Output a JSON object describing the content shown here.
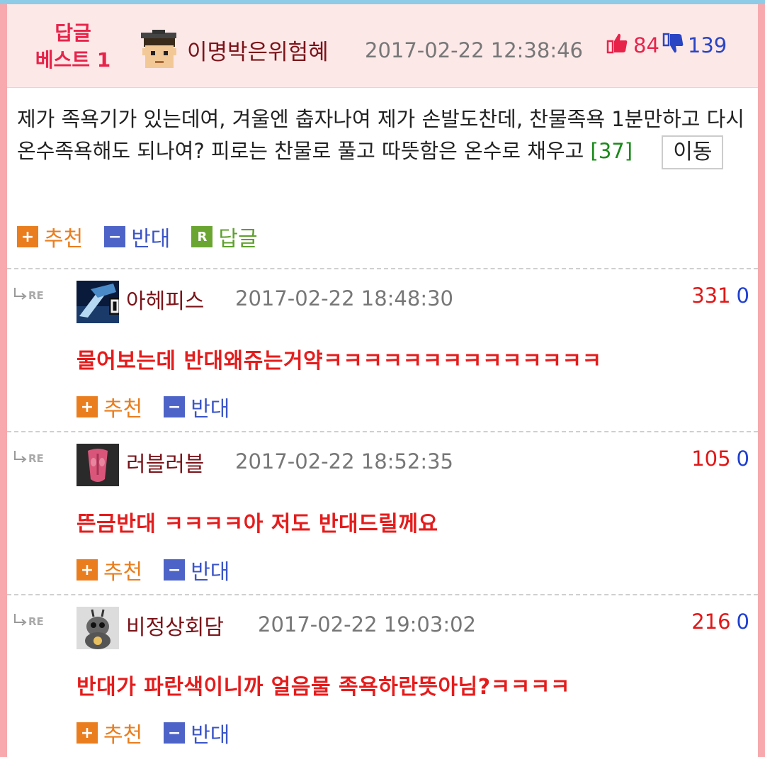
{
  "best": {
    "badge_line1": "답글",
    "badge_line2": "베스트 1",
    "author": "이명박은위험혜",
    "date": "2017-02-22 12:38:46",
    "up_count": "84",
    "down_count": "139"
  },
  "post": {
    "text": "제가 족욕기가 있는데여, 겨울엔 춥자나여 제가 손발도찬데, 찬물족욕 1분만하고 다시 온수족욕해도 되나여? 피로는 찬물로 풀고 따뜻함은 온수로 채우고",
    "comment_count": "[37]",
    "move_label": "이동"
  },
  "actions": {
    "recommend": "추천",
    "oppose": "반대",
    "reply": "답글",
    "r_icon": "R"
  },
  "replies": [
    {
      "author": "아헤피스",
      "date": "2017-02-22 18:48:30",
      "up": "331",
      "down": "0",
      "text": "물어보는데 반대왜쥬는거약ㅋㅋㅋㅋㅋㅋㅋㅋㅋㅋㅋㅋㅋㅋ"
    },
    {
      "author": "러블러블",
      "date": "2017-02-22 18:52:35",
      "up": "105",
      "down": "0",
      "text": "뜬금반대 ㅋㅋㅋㅋ아 저도 반대드릴께요"
    },
    {
      "author": "비정상회담",
      "date": "2017-02-22 19:03:02",
      "up": "216",
      "down": "0",
      "text": "반대가 파란색이니까 얼음물 족욕하란뜻아님?ㅋㅋㅋㅋ"
    }
  ],
  "re_label": "RE",
  "colors": {
    "accent_red": "#e51c1c",
    "recommend_orange": "#ea7d1d",
    "oppose_blue": "#4d63c7",
    "reply_green": "#6aa531",
    "border_pink": "#f7a9ae"
  },
  "icons": {
    "thumbs_up": "thumbs-up-icon",
    "thumbs_down": "thumbs-down-icon",
    "reply_arrow": "reply-arrow-icon"
  }
}
